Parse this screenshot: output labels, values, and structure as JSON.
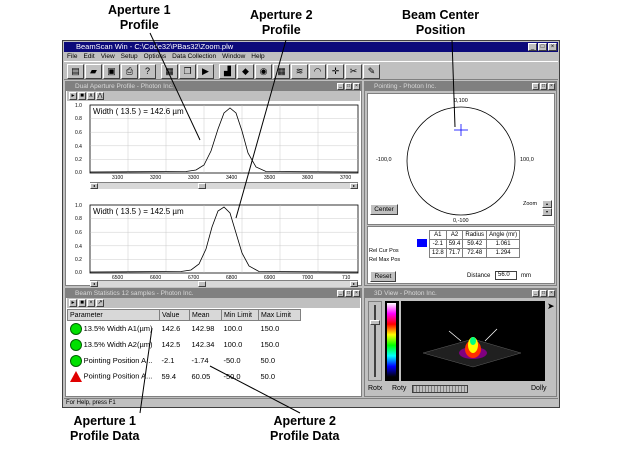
{
  "callouts": {
    "aperture1_profile": [
      "Aperture 1",
      "Profile"
    ],
    "aperture2_profile": [
      "Aperture 2",
      "Profile"
    ],
    "beam_center": [
      "Beam Center",
      "Position"
    ],
    "aperture1_data": [
      "Aperture 1",
      "Profile Data"
    ],
    "aperture2_data": [
      "Aperture 2",
      "Profile Data"
    ]
  },
  "app": {
    "title": "BeamScan Win - C:\\Code32\\PBas32\\Zoom.plw",
    "menu": [
      "File",
      "Edit",
      "View",
      "Setup",
      "Options",
      "Data Collection",
      "Window",
      "Help"
    ],
    "statusbar": "For Help, press F1"
  },
  "profile_window": {
    "title": "Dual Aperture Profile - Photon Inc.",
    "plot1": {
      "label": "Width ( 13.5 ) = 142.6 µm",
      "y_ticks": [
        "1.0",
        "0.8",
        "0.6",
        "0.4",
        "0.2",
        "0.0"
      ],
      "x_ticks": [
        "3100",
        "3200",
        "3300",
        "3400",
        "3500",
        "3600",
        "3700"
      ]
    },
    "plot2": {
      "label": "Width ( 13.5 ) = 142.5 µm",
      "y_ticks": [
        "1.0",
        "0.8",
        "0.6",
        "0.4",
        "0.2",
        "0.0"
      ],
      "x_ticks": [
        "6500",
        "6600",
        "6700",
        "6800",
        "6900",
        "7000",
        "710"
      ]
    }
  },
  "pointing_window": {
    "title": "Pointing - Photon Inc.",
    "labels": {
      "top": "0,100",
      "left": "-100,0",
      "right": "100,0",
      "bottom": "0,-100"
    },
    "center_button": "Center",
    "zoom_label": "Zoom",
    "table": {
      "headers": [
        "A1",
        "A2",
        "Radius",
        "Angle (mr)"
      ],
      "rows": [
        {
          "label": "Rel Cur Pos",
          "values": [
            "-2.1",
            "59.4",
            "59.42",
            "1.061"
          ]
        },
        {
          "label": "Rel Max Pos",
          "values": [
            "12.8",
            "71.7",
            "72.48",
            "1.294"
          ]
        }
      ]
    },
    "reset_button": "Reset",
    "distance_label": "Distance",
    "distance_value": "56.0",
    "distance_unit": "mm",
    "accent": "#0000ff"
  },
  "stats_window": {
    "title": "Beam Statistics 12 samples - Photon Inc.",
    "headers": [
      "Parameter",
      "Value",
      "Mean",
      "Min Limit",
      "Max Limit"
    ],
    "rows": [
      {
        "icon": "green-circle",
        "param": "13.5% Width A1(µm)",
        "value": "142.6",
        "mean": "142.98",
        "min": "100.0",
        "max": "150.0"
      },
      {
        "icon": "green-circle",
        "param": "13.5% Width A2(µm)",
        "value": "142.5",
        "mean": "142.34",
        "min": "100.0",
        "max": "150.0"
      },
      {
        "icon": "green-circle",
        "param": "Pointing Position A...",
        "value": "-2.1",
        "mean": "-1.74",
        "min": "-50.0",
        "max": "50.0"
      },
      {
        "icon": "red-triangle",
        "param": "Pointing Position A...",
        "value": "59.4",
        "mean": "60.05",
        "min": "-50.0",
        "max": "50.0"
      }
    ],
    "ok_color": "#00e000",
    "fail_color": "#e00000"
  },
  "view3d_window": {
    "title": "3D View - Photon Inc.",
    "rotx": "Rotx",
    "roty": "Roty",
    "dolly": "Dolly"
  }
}
